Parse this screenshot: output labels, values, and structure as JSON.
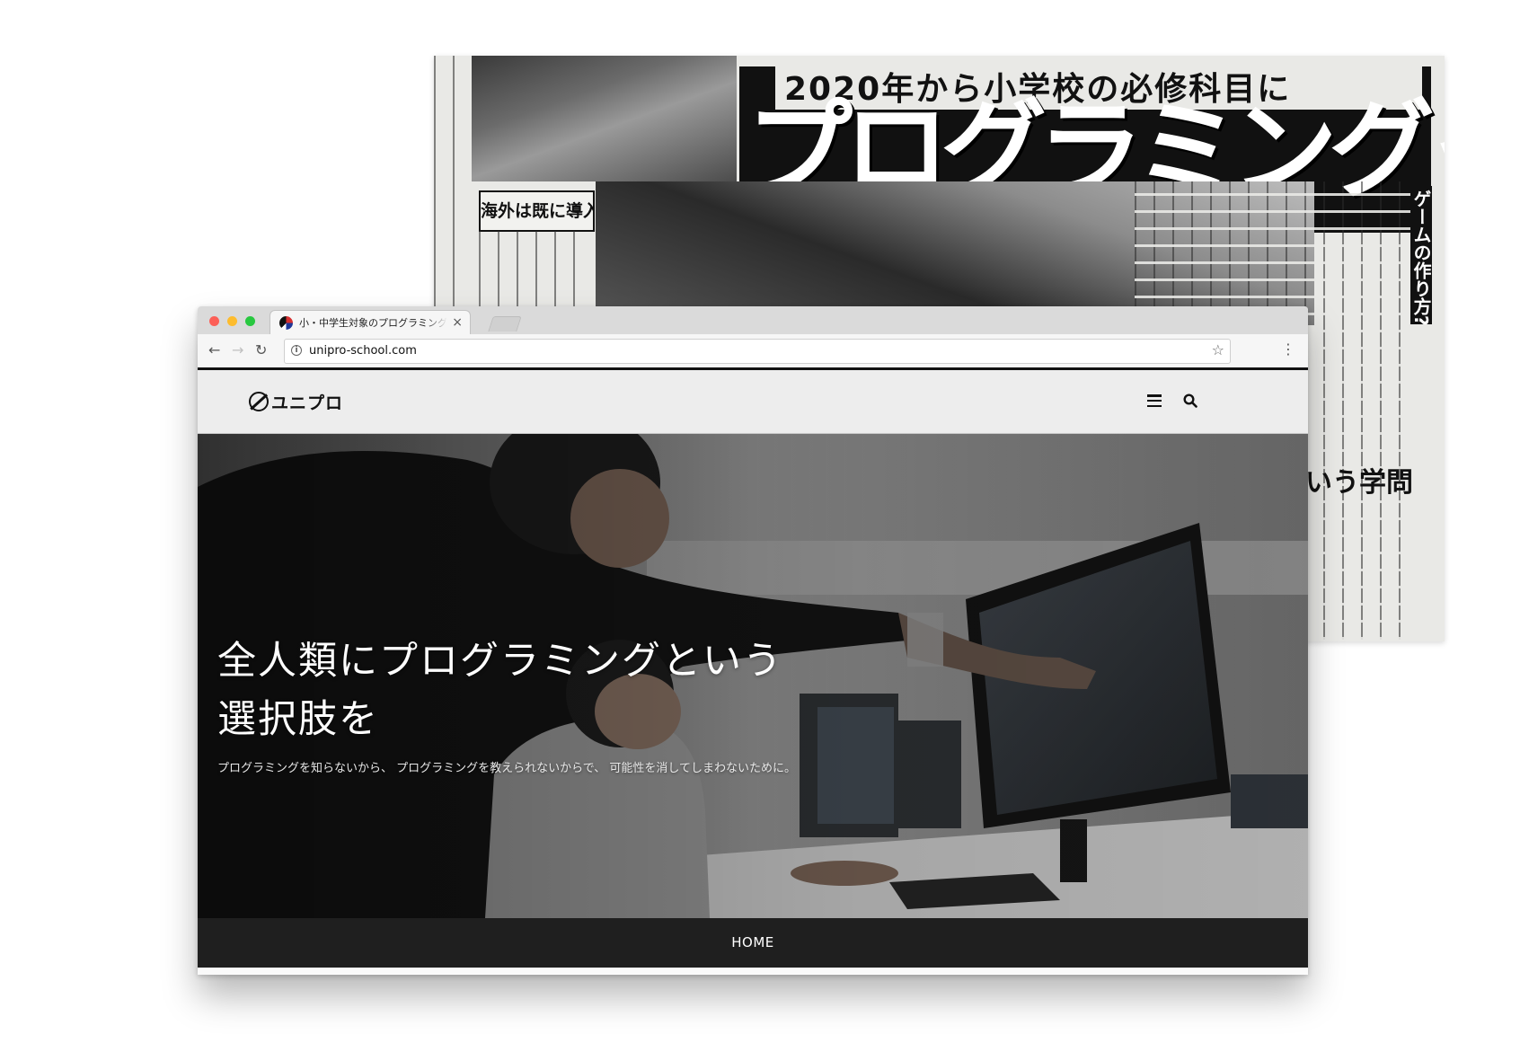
{
  "newspaper": {
    "headline_top": "2020年から小学校の必修科目に",
    "headline": "プログラミングって何?",
    "box_heading": "海外は既に導入",
    "side_heading": "ゲームの作り方?",
    "mid_heading": "、という学問"
  },
  "browser": {
    "tab_title": "小・中学生対象のプログラミング",
    "tab_close": "×",
    "url": "unipro-school.com",
    "nav_back": "←",
    "nav_forward": "→",
    "nav_reload": "↻",
    "star": "☆",
    "menu": "⋮"
  },
  "site": {
    "logo_text": "ユニプロ",
    "hero_title": "全人類にプログラミングという選択肢を",
    "hero_subtitle": "プログラミングを知らないから、 プログラミングを教えられないからで、 可能性を消してしまわないために。",
    "nav_home": "HOME"
  },
  "colors": {
    "nav_bar": "#1f1f1f",
    "header_bg": "#ececec",
    "traffic_red": "#fc5f57",
    "traffic_yellow": "#fdbc2e",
    "traffic_green": "#28c840"
  }
}
